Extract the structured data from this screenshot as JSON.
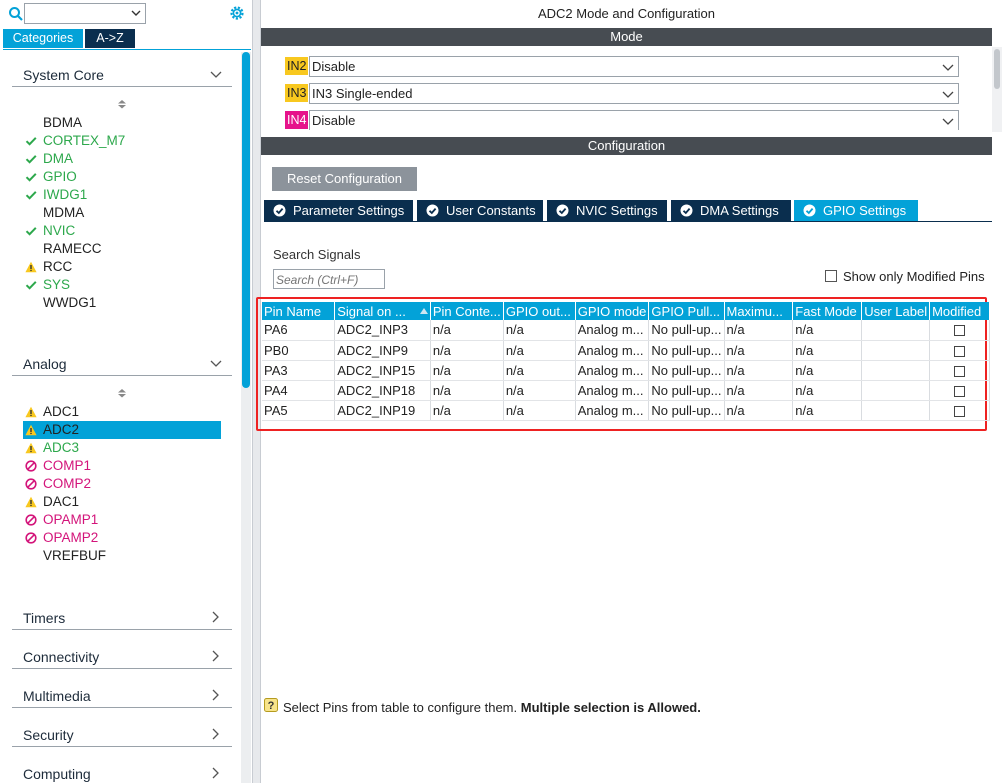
{
  "left_panel": {
    "search": {
      "placeholder": ""
    },
    "tabs": {
      "categories": "Categories",
      "az": "A->Z"
    },
    "groups": {
      "system_core": {
        "label": "System Core",
        "items": [
          {
            "label": "BDMA",
            "status": "none"
          },
          {
            "label": "CORTEX_M7",
            "status": "ok"
          },
          {
            "label": "DMA",
            "status": "ok"
          },
          {
            "label": "GPIO",
            "status": "ok"
          },
          {
            "label": "IWDG1",
            "status": "ok"
          },
          {
            "label": "MDMA",
            "status": "none"
          },
          {
            "label": "NVIC",
            "status": "ok"
          },
          {
            "label": "RAMECC",
            "status": "none"
          },
          {
            "label": "RCC",
            "status": "warning"
          },
          {
            "label": "SYS",
            "status": "ok"
          },
          {
            "label": "WWDG1",
            "status": "none"
          }
        ]
      },
      "analog": {
        "label": "Analog",
        "items": [
          {
            "label": "ADC1",
            "status": "warning"
          },
          {
            "label": "ADC2",
            "status": "warning",
            "selected": true
          },
          {
            "label": "ADC3",
            "status": "warning"
          },
          {
            "label": "COMP1",
            "status": "disabled"
          },
          {
            "label": "COMP2",
            "status": "disabled"
          },
          {
            "label": "DAC1",
            "status": "warning"
          },
          {
            "label": "OPAMP1",
            "status": "disabled"
          },
          {
            "label": "OPAMP2",
            "status": "disabled"
          },
          {
            "label": "VREFBUF",
            "status": "none"
          }
        ]
      },
      "collapsed": [
        {
          "label": "Timers"
        },
        {
          "label": "Connectivity"
        },
        {
          "label": "Multimedia"
        },
        {
          "label": "Security"
        },
        {
          "label": "Computing"
        }
      ]
    }
  },
  "right_panel": {
    "title": "ADC2 Mode and Configuration",
    "mode_header": "Mode",
    "mode_rows": [
      {
        "tag": "IN2",
        "tag_color": "yellow",
        "value": "Disable"
      },
      {
        "tag": "IN3",
        "tag_color": "yellow",
        "value": "IN3 Single-ended"
      },
      {
        "tag": "IN4",
        "tag_color": "magenta",
        "value": "Disable"
      }
    ],
    "config_header": "Configuration",
    "reset_button": "Reset Configuration",
    "tabs": [
      {
        "label": "Parameter Settings",
        "active": false
      },
      {
        "label": "User Constants",
        "active": false
      },
      {
        "label": "NVIC Settings",
        "active": false
      },
      {
        "label": "DMA Settings",
        "active": false
      },
      {
        "label": "GPIO Settings",
        "active": true
      }
    ],
    "search_signals": {
      "label": "Search Signals",
      "placeholder": "Search (Ctrl+F)"
    },
    "show_only_modified": "Show only Modified Pins",
    "table": {
      "columns": [
        "Pin Name",
        "Signal on ...",
        "Pin Conte...",
        "GPIO out...",
        "GPIO mode",
        "GPIO Pull...",
        "Maximu...",
        "Fast Mode",
        "User Label",
        "Modified"
      ],
      "rows": [
        [
          "PA6",
          "ADC2_INP3",
          "n/a",
          "n/a",
          "Analog m...",
          "No pull-up...",
          "n/a",
          "n/a",
          "",
          ""
        ],
        [
          "PB0",
          "ADC2_INP9",
          "n/a",
          "n/a",
          "Analog m...",
          "No pull-up...",
          "n/a",
          "n/a",
          "",
          ""
        ],
        [
          "PA3",
          "ADC2_INP15",
          "n/a",
          "n/a",
          "Analog m...",
          "No pull-up...",
          "n/a",
          "n/a",
          "",
          ""
        ],
        [
          "PA4",
          "ADC2_INP18",
          "n/a",
          "n/a",
          "Analog m...",
          "No pull-up...",
          "n/a",
          "n/a",
          "",
          ""
        ],
        [
          "PA5",
          "ADC2_INP19",
          "n/a",
          "n/a",
          "Analog m...",
          "No pull-up...",
          "n/a",
          "n/a",
          "",
          ""
        ]
      ]
    },
    "hint": {
      "normal": "Select Pins from table to configure them.",
      "bold": "Multiple selection is Allowed."
    }
  },
  "colors": {
    "accent": "#03a2d8",
    "dark_navy": "#0a2e4e",
    "header_bar": "#474c52",
    "ok_green": "#2da84c",
    "warning_yellow": "#f8c81f",
    "disabled_magenta": "#d3147a",
    "highlight_red": "#e22222"
  }
}
